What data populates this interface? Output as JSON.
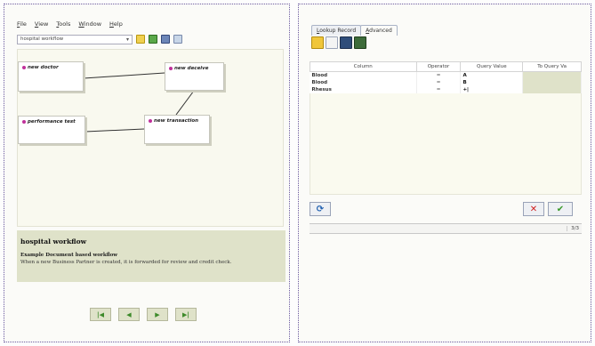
{
  "left": {
    "menu": [
      "File",
      "View",
      "Tools",
      "Window",
      "Help"
    ],
    "workflow_select": "hospital workflow",
    "nodes": [
      {
        "label": "new doctor"
      },
      {
        "label": "new deceive"
      },
      {
        "label": "performance test"
      },
      {
        "label": "new transaction"
      }
    ],
    "info": {
      "title": "hospital workflow",
      "subtitle": "Example Document based workflow",
      "description": "When a new Business Partner is created, it is forwarded for review and credit check."
    },
    "nav_buttons": [
      "|◀",
      "◀",
      "▶",
      "▶|"
    ]
  },
  "right": {
    "tabs": [
      "Lookup Record",
      "Advanced"
    ],
    "columns": [
      "Column",
      "Operator",
      "Query Value",
      "To Query Va"
    ],
    "rows": [
      {
        "column": "Blood",
        "operator": "=",
        "value": "A",
        "to": ""
      },
      {
        "column": "Blood",
        "operator": "=",
        "value": "B",
        "to": ""
      },
      {
        "column": "Rhesus",
        "operator": "=",
        "value": "+|",
        "to": ""
      }
    ],
    "status_count": "3/3"
  },
  "colors": {
    "panel_border": "#6b5aa0",
    "info_bg": "#dfe2c9",
    "node_dot": "#c0309a"
  }
}
